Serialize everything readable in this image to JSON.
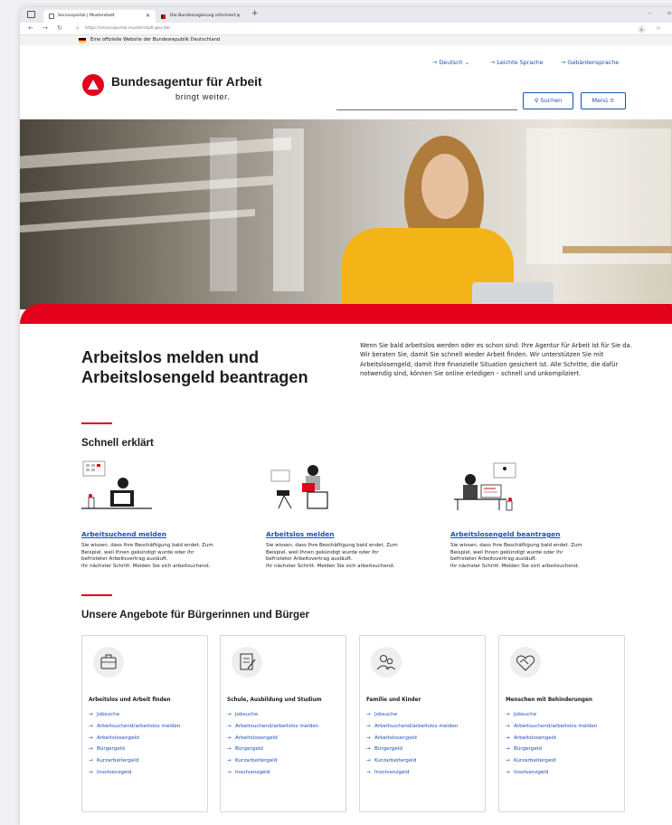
{
  "browser": {
    "tabs": [
      {
        "title": "Serviceportal | Musterstadt",
        "active": true
      },
      {
        "title": "Die Bundesregierung informiert",
        "active": false
      }
    ],
    "url": "https://serviceportal.musterstadt.gov.de/"
  },
  "official_bar": {
    "text": "Eine offizielle Website der Bundesrepublik Deutschland"
  },
  "header": {
    "top_links": [
      "Deutsch",
      "Leichte Sprache",
      "Gebärdensprache"
    ],
    "brand": {
      "name": "Bundesagentur für Arbeit",
      "tagline": "bringt weiter."
    },
    "search": {
      "placeholder": "",
      "button": "Suchen"
    },
    "menu": "Menü"
  },
  "intro": {
    "title": "Arbeitslos melden und Arbeitslosengeld beantragen",
    "text": "Wenn Sie bald arbeitslos werden oder es schon sind: Ihre Agentur für Arbeit ist für Sie da. Wir beraten Sie, damit Sie schnell wieder Arbeit finden. Wir unterstützen Sie mit Arbeitslosengeld, damit Ihre finanzielle Situation gesichert ist. Alle Schritte, die dafür notwendig sind, können Sie online erledigen – schnell und unkompliziert."
  },
  "quick": {
    "heading": "Schnell erklärt",
    "items": [
      {
        "link": "Arbeitsuchend melden",
        "lines": [
          "Sie wissen, dass Ihre Beschäftigung bald endet. Zum",
          "Beispiel, weil Ihnen gekündigt wurde oder Ihr",
          "befristeter Arbeitsvertrag ausläuft.",
          "Ihr nächster Schritt: Melden Sie sich arbeitsuchend."
        ]
      },
      {
        "link": "Arbeitslos melden",
        "lines": [
          "Sie wissen, dass Ihre Beschäftigung bald endet. Zum",
          "Beispiel, weil Ihnen gekündigt wurde oder Ihr",
          "befristeter Arbeitsvertrag ausläuft.",
          "Ihr nächster Schritt: Melden Sie sich arbeitsuchend."
        ]
      },
      {
        "link": "Arbeitslosengeld beantragen",
        "lines": [
          "Sie wissen, dass Ihre Beschäftigung bald endet. Zum",
          "Beispiel, weil Ihnen gekündigt wurde oder Ihr",
          "befristeter Arbeitsvertrag ausläuft.",
          "Ihr nächster Schritt: Melden Sie sich arbeitsuchend."
        ]
      }
    ]
  },
  "offers": {
    "heading": "Unsere Angebote für Bürgerinnen und Bürger",
    "cards": [
      {
        "title": "Arbeitslos und Arbeit finden",
        "icon": "briefcase-icon",
        "links": [
          "Jobsuche",
          "Arbeitsuchend/arbeitslos melden",
          "Arbeitslosengeld",
          "Bürgergeld",
          "Kurzarbeitergeld",
          "Insolvenzgeld"
        ]
      },
      {
        "title": "Schule, Ausbildung und Studium",
        "icon": "document-pen-icon",
        "links": [
          "Jobsuche",
          "Arbeitsuchend/arbeitslos melden",
          "Arbeitslosengeld",
          "Bürgergeld",
          "Kurzarbeitergeld",
          "Insolvenzgeld"
        ]
      },
      {
        "title": "Familie und Kinder",
        "icon": "family-icon",
        "links": [
          "Jobsuche",
          "Arbeitsuchend/arbeitslos melden",
          "Arbeitslosengeld",
          "Bürgergeld",
          "Kurzarbeitergeld",
          "Insolvenzgeld"
        ]
      },
      {
        "title": "Menschen mit Behinderungen",
        "icon": "handshake-heart-icon",
        "links": [
          "Jobsuche",
          "Arbeitsuchend/arbeitslos melden",
          "Arbeitslosengeld",
          "Bürgergeld",
          "Kurzarbeitergeld",
          "Insolvenzgeld"
        ]
      }
    ]
  },
  "colors": {
    "brand_red": "#e2001a",
    "link_blue": "#1b4fb8",
    "text": "#1d1d1b"
  }
}
